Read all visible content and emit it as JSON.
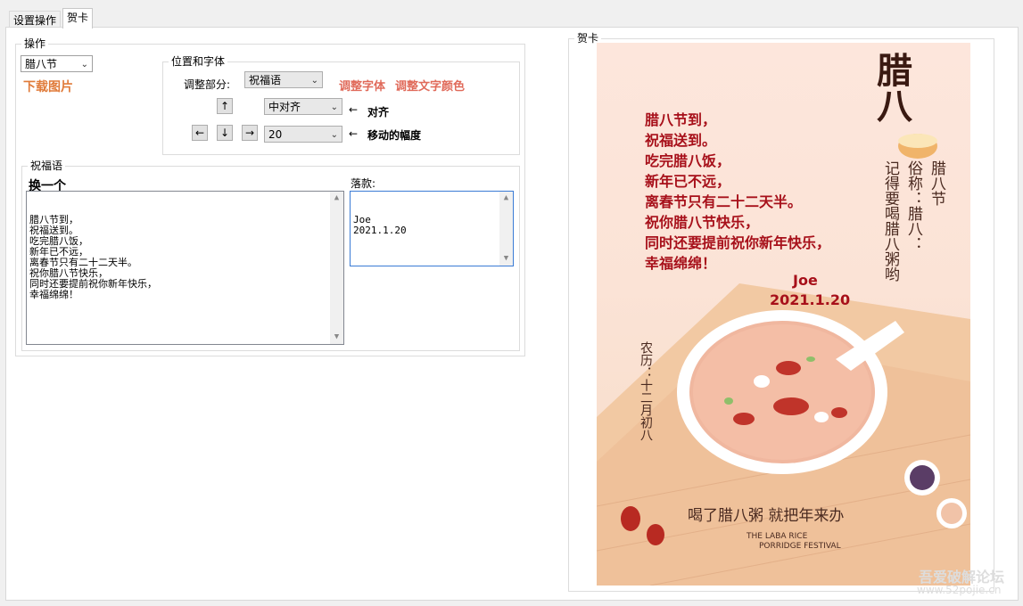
{
  "tabs": [
    {
      "label": "设置操作"
    },
    {
      "label": "贺卡"
    }
  ],
  "ops_group": {
    "title": "操作",
    "festival_combo": "腊八节",
    "download_link": "下载图片",
    "pos_font_group": {
      "title": "位置和字体",
      "adjust_part_label": "调整部分:",
      "adjust_part_value": "祝福语",
      "adjust_font_link": "调整字体",
      "adjust_color_link": "调整文字颜色",
      "align_value": "中对齐",
      "align_label": "对齐",
      "step_value": "20",
      "step_label": "移动的幅度",
      "arrow_up": "↑",
      "arrow_left": "←",
      "arrow_down": "↓",
      "arrow_right": "→",
      "pointer": "←"
    }
  },
  "blessing_group": {
    "title": "祝福语",
    "change_one": "换一个",
    "text": "腊八节到，\n祝福送到。\n吃完腊八饭，\n新年已不远，\n离春节只有二十二天半。\n祝你腊八节快乐，\n同时还要提前祝你新年快乐，\n幸福绵绵！",
    "signature_label": "落款:",
    "signature_text": "Joe\n2021.1.20"
  },
  "card_group": {
    "title": "贺卡"
  },
  "card": {
    "blessing_lines": [
      "腊八节到，",
      "祝福送到。",
      "吃完腊八饭，",
      "新年已不远，",
      "离春节只有二十二天半。",
      "祝你腊八节快乐，",
      "同时还要提前祝你新年快乐，",
      "幸福绵绵！"
    ],
    "sig_name": "Joe",
    "sig_date": "2021.1.20",
    "title_chars": "腊八",
    "vertical_col1": "腊八节",
    "vertical_col2": "俗称：腊八：",
    "vertical_col3": "记得要喝腊八粥哟",
    "lunar": "农历：十二月初八",
    "slogan": "喝了腊八粥 就把年来办",
    "en_line1": "THE LABA RICE",
    "en_line2": "PORRIDGE FESTIVAL"
  },
  "watermark": {
    "line1": "吾爱破解论坛",
    "line2": "www.52pojie.cn"
  },
  "colors": {
    "accent_orange": "#e07b3a",
    "link_red": "#e06a5a",
    "card_text": "#a7101a"
  }
}
